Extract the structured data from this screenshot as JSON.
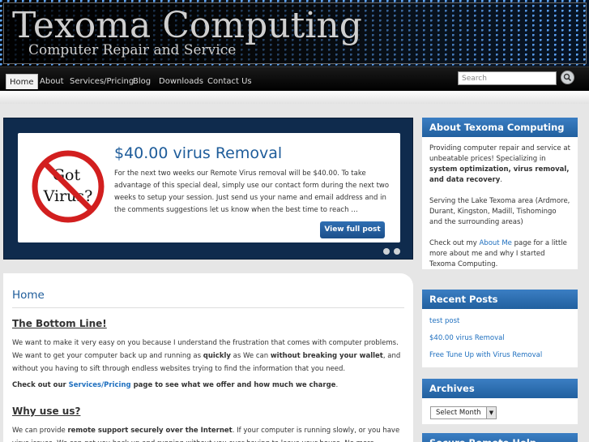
{
  "header": {
    "title": "Texoma Computing",
    "tagline": "Computer Repair and Service"
  },
  "nav": {
    "items": [
      "Home",
      "About",
      "Services/Pricing",
      "Blog",
      "Downloads",
      "Contact Us"
    ],
    "active": "Home"
  },
  "search": {
    "placeholder": "Search",
    "button_icon": "search-icon"
  },
  "featured": {
    "graphic_text_line1": "Got",
    "graphic_text_line2": "Virus?",
    "title": "$40.00 virus Removal",
    "excerpt": "For the next two weeks our Remote Virus removal will be $40.00. To take advantage of this special deal, simply use our contact form during the next two weeks to setup your session. Just send us your name and email address and in the comments suggestions let us know when the best time to reach …",
    "button_label": "View full post",
    "dots": 2
  },
  "main": {
    "heading": "Home",
    "section1_title": "The Bottom Line!",
    "para1_part1": "We want to make it very easy on you because I understand the frustration that comes with computer problems. We want to get your computer back up and running as ",
    "para1_bold1": "quickly",
    "para1_part2": " as We can ",
    "para1_bold2": "without breaking your wallet",
    "para1_part3": ", and without you having to sift through endless websites trying to find the information that you need.",
    "para2_part1": "Check out our ",
    "para2_link": "Services/Pricing",
    "para2_part2": " page to see what we offer and how much we charge",
    "para2_end": ".",
    "section2_title": "Why use us?",
    "para3_part1": "We can provide ",
    "para3_bold": "remote support securely over the Internet",
    "para3_part2": ". If your computer is running slowly, or you have virus issues. We can get you back up and running without you ever having to leave your house. No more unhooking cables"
  },
  "sidebar": {
    "about": {
      "title": "About Texoma Computing",
      "p1_part1": "Providing computer repair and service at unbeatable prices! Specializing in ",
      "p1_bold": "system optimization, virus removal, and data recovery",
      "p1_end": ".",
      "p2": "Serving the Lake Texoma area (Ardmore, Durant, Kingston, Madill, Tishomingo and the surrounding areas)",
      "p3_part1": "Check out my ",
      "p3_link": "About Me",
      "p3_part2": " page for a little more about me and why I started Texoma Computing."
    },
    "recent": {
      "title": "Recent Posts",
      "items": [
        "test post",
        "$40.00 virus Removal",
        "Free Tune Up with Virus Removal"
      ]
    },
    "archives": {
      "title": "Archives",
      "select_value": "Select Month"
    },
    "secure": {
      "title": "Secure Remote Help"
    }
  },
  "colors": {
    "accent_blue": "#1e5c9a",
    "widget_header": "#2a6cae",
    "slider_bg": "#0f2b4d",
    "prohibit_red": "#d21f1f"
  }
}
